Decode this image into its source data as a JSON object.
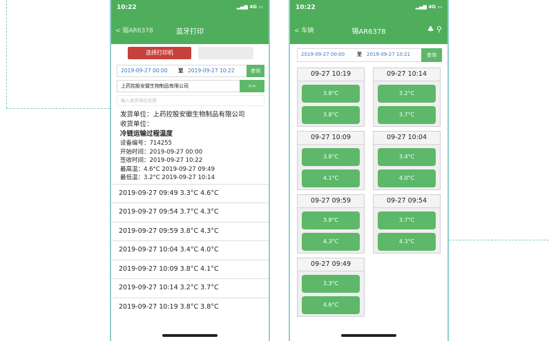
{
  "left_phone": {
    "status_time": "10:22",
    "status_signal": "4G",
    "nav_back": "< 锡AR6378",
    "nav_title": "蓝牙打印",
    "select_printer_button": "选择打印机",
    "date_start": "2019-09-27 00:00",
    "date_sep": "至",
    "date_end": "2019-09-27 10:22",
    "query_button": "查询",
    "company": "上药控股安徽生物制品有限公司",
    "company_button": ">>",
    "input_placeholder": "输入收货单位名称",
    "info": {
      "shipper": "发货单位：上药控股安徽生物制品有限公司",
      "receiver": "收货单位：",
      "heading": "冷链运输过程温度",
      "device": "设备编号：714255",
      "start": "开始时间：2019-09-27 00:00",
      "sign": "签收时间：2019-09-27 10:22",
      "max": "最高温：4.6°C  2019-09-27 09:49",
      "min": "最低温：3.2°C  2019-09-27 10:14"
    },
    "records": [
      "2019-09-27 09:49  3.3°C  4.6°C",
      "2019-09-27 09:54  3.7°C  4.3°C",
      "2019-09-27 09:59  3.8°C  4.3°C",
      "2019-09-27 10:04  3.4°C  4.0°C",
      "2019-09-27 10:09  3.8°C  4.1°C",
      "2019-09-27 10:14  3.2°C  3.7°C",
      "2019-09-27 10:19  3.8°C  3.8°C"
    ]
  },
  "right_phone": {
    "status_time": "10:22",
    "status_signal": "4G",
    "nav_back": "< 车辆",
    "nav_title": "锡AR6378",
    "nav_icons": "♣ ⚲",
    "date_start": "2019-09-27 00:00",
    "date_sep": "至",
    "date_end": "2019-09-27 10:21",
    "query_button": "查询",
    "cards": [
      {
        "time": "09-27 10:19",
        "t1": "3.8°C",
        "t2": "3.8°C"
      },
      {
        "time": "09-27 10:14",
        "t1": "3.2°C",
        "t2": "3.7°C"
      },
      {
        "time": "09-27 10:09",
        "t1": "3.8°C",
        "t2": "4.1°C"
      },
      {
        "time": "09-27 10:04",
        "t1": "3.4°C",
        "t2": "4.0°C"
      },
      {
        "time": "09-27 09:59",
        "t1": "3.8°C",
        "t2": "4.3°C"
      },
      {
        "time": "09-27 09:54",
        "t1": "3.7°C",
        "t2": "4.3°C"
      },
      {
        "time": "09-27 09:49",
        "t1": "3.3°C",
        "t2": "4.6°C"
      }
    ]
  },
  "colors": {
    "header_green": "#4fae5b",
    "button_green": "#5db86a",
    "button_red": "#c8403b",
    "accent_teal": "#8fcfcc"
  }
}
